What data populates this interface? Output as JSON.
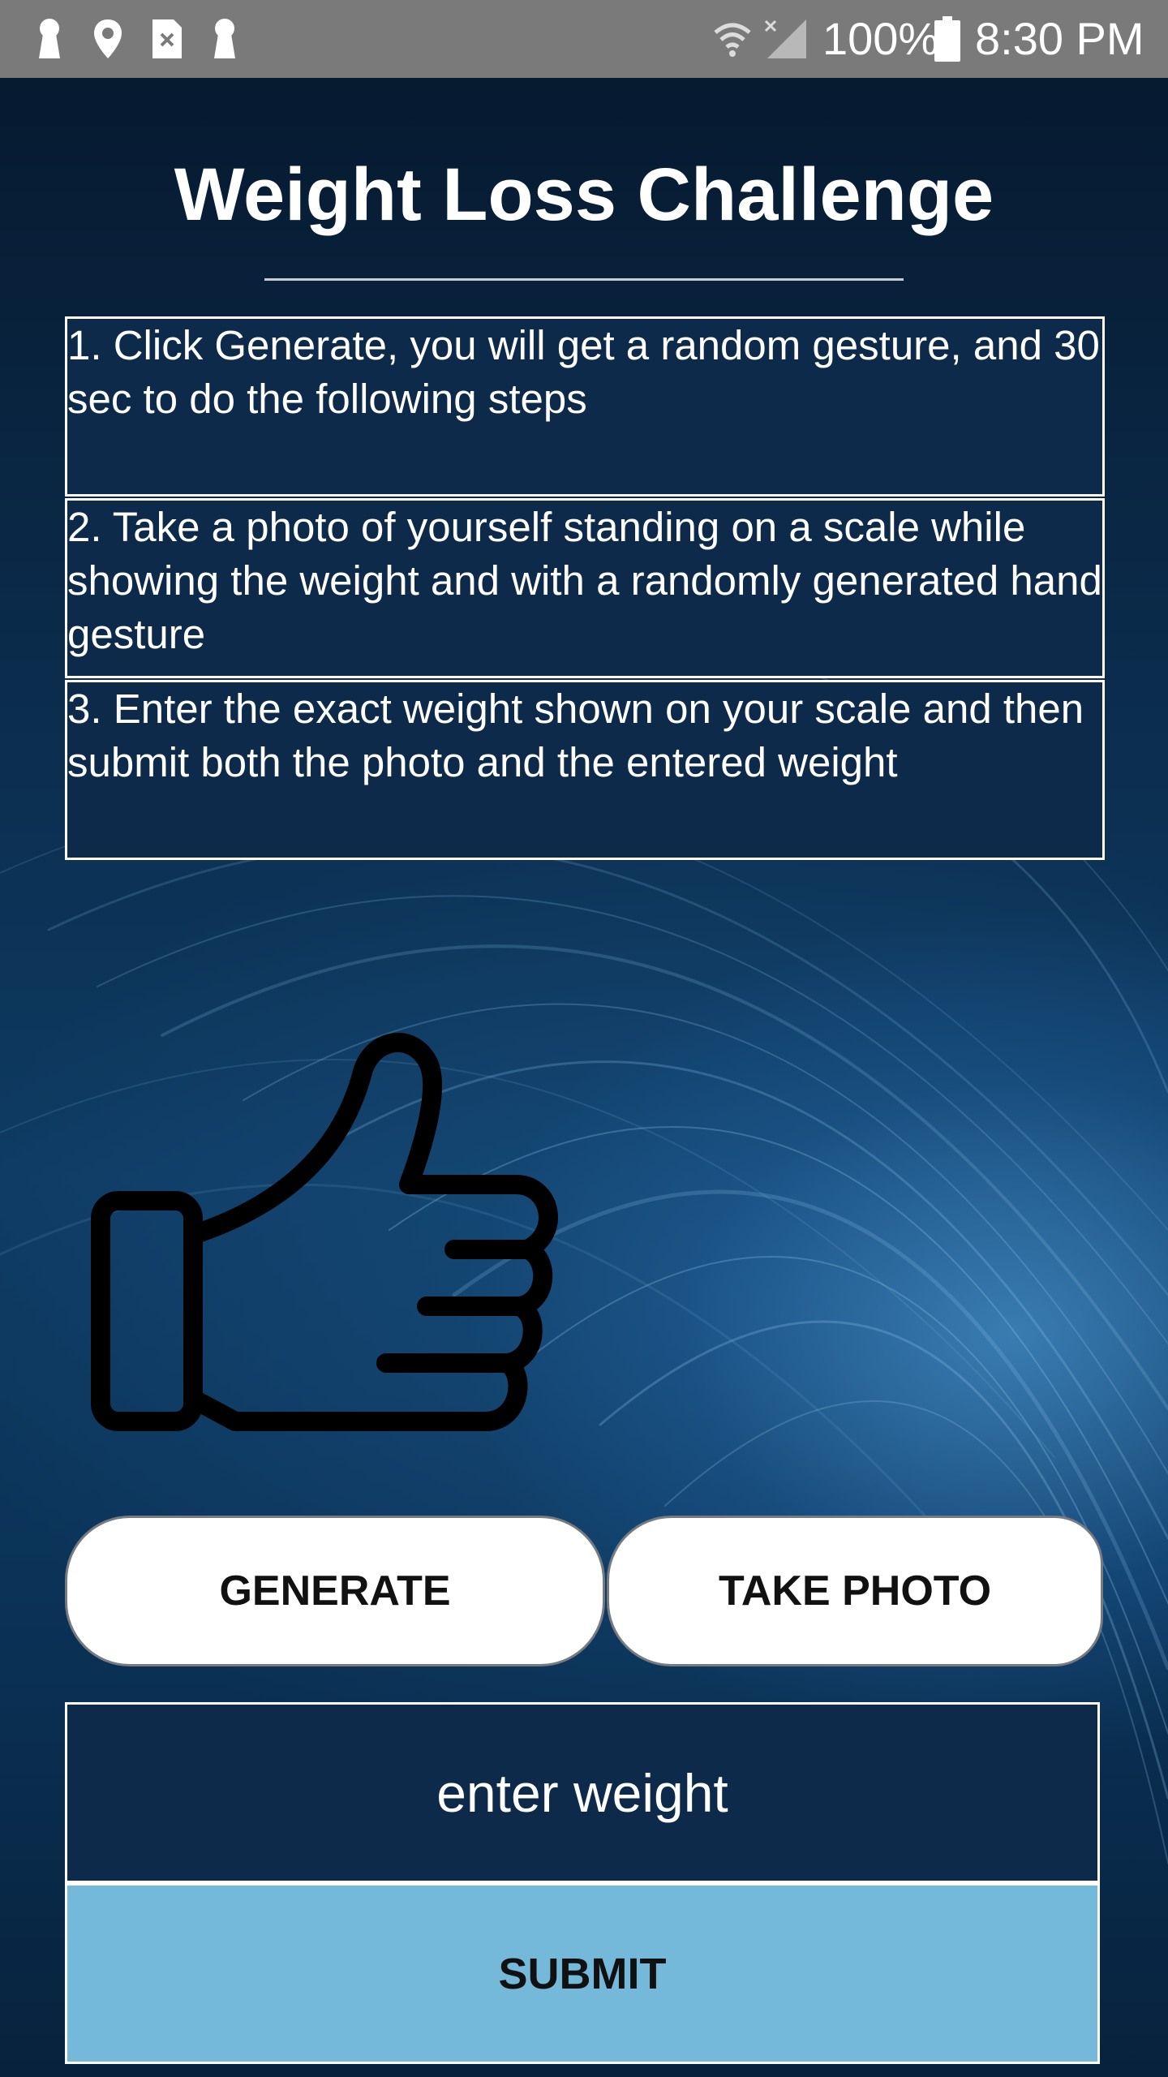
{
  "status_bar": {
    "battery_percent": "100%",
    "time": "8:30 PM",
    "left_icons": [
      "keyhole-icon",
      "location-pin-icon",
      "sim-error-icon",
      "keyhole-icon"
    ],
    "right_icons": [
      "wifi-icon",
      "no-signal-icon",
      "battery-full-icon"
    ]
  },
  "header": {
    "title": "Weight Loss Challenge"
  },
  "steps": [
    "1. Click Generate, you will get a random gesture, and 30 sec to do the following steps",
    "2. Take a photo of yourself standing on a scale while showing the weight and with a randomly generated hand gesture",
    "3. Enter the exact weight shown on your scale and then submit both the photo and the entered weight"
  ],
  "gesture": {
    "icon": "thumbs-up-icon"
  },
  "actions": {
    "generate_label": "GENERATE",
    "take_photo_label": "TAKE PHOTO"
  },
  "weight": {
    "placeholder": "enter weight",
    "value": ""
  },
  "submit_label": "SUBMIT",
  "colors": {
    "status_bar": "#7a7a7a",
    "panel": "#0d2a4b",
    "submit": "#74b8da",
    "text_light": "#ffffff",
    "text_dark": "#111111"
  }
}
